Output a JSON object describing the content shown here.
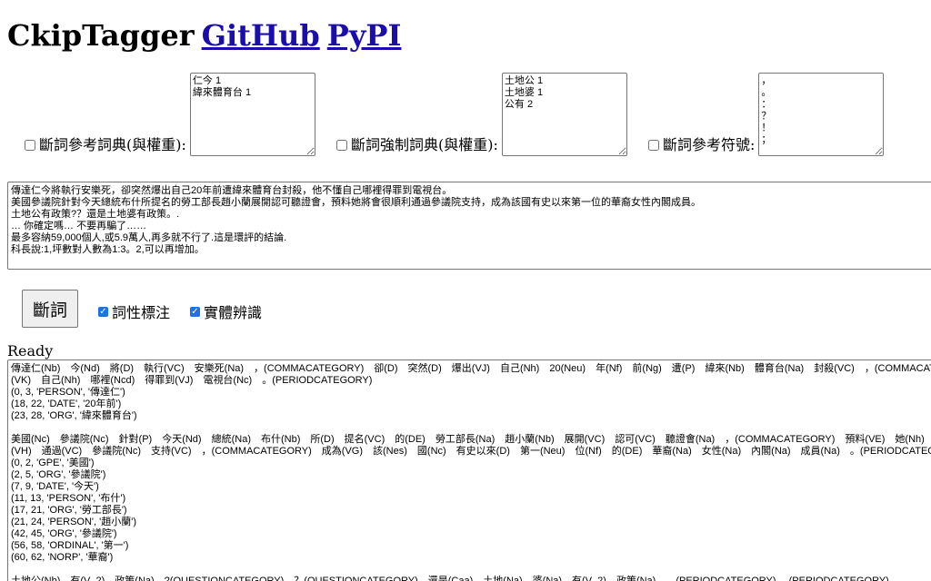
{
  "header": {
    "title": "CkipTagger",
    "github_link": "GitHub",
    "pypi_link": "PyPI"
  },
  "options": {
    "recommend_dict": {
      "label": "斷詞參考詞典(與權重):",
      "checked": false,
      "value": "仁今 1\n緯來體育台 1"
    },
    "coerce_dict": {
      "label": "斷詞強制詞典(與權重):",
      "checked": false,
      "value": "土地公 1\n土地婆 1\n公有 2"
    },
    "delimiters": {
      "label": "斷詞參考符號:",
      "checked": false,
      "value": "，\n。\n：\n？\n！\n；"
    }
  },
  "input_text": "傳達仁今將執行安樂死，卻突然爆出自己20年前遭緯來體育台封殺，他不懂自己哪裡得罪到電視台。\n美國參議院針對今天總統布什所提名的勞工部長趙小蘭展開認可聽證會，預料她將會很順利通過參議院支持，成為該國有史以來第一位的華裔女性內閣成員。\n土地公有政策?？還是土地婆有政策。.\n… 你確定嗎… 不要再騙了……\n最多容納59,000個人,或5.9萬人,再多就不行了.這是環評的結論.\n科長說:1,坪數對人數為1:3。2,可以再增加。",
  "controls": {
    "run_button": "斷詞",
    "pos_label": "詞性標注",
    "pos_checked": true,
    "ner_label": "實體辨識",
    "ner_checked": true
  },
  "status": "Ready",
  "output_text": "傳達仁(Nb)　今(Nd)　將(D)　執行(VC)　安樂死(Na)　，(COMMACATEGORY)　卻(D)　突然(D)　爆出(VJ)　自己(Nh)　20(Neu)　年(Nf)　前(Ng)　遭(P)　緯來(Nb)　體育台(Na)　封殺(VC)　，(COMMACATEGORY)　他(Nh)　不(D)　懂\n(VK)　自己(Nh)　哪裡(Ncd)　得罪到(VJ)　電視台(Nc)　。(PERIODCATEGORY)\n(0, 3, 'PERSON', '傳達仁')\n(18, 22, 'DATE', '20年前')\n(23, 28, 'ORG', '緯來體育台')\n\n美國(Nc)　參議院(Nc)　針對(P)　今天(Nd)　總統(Na)　布什(Nb)　所(D)　提名(VC)　的(DE)　勞工部長(Na)　趙小蘭(Nb)　展開(VC)　認可(VC)　聽證會(Na)　，(COMMACATEGORY)　預料(VE)　她(Nh)　將(D)　會(D)　很(Dfa)　順利\n(VH)　通過(VC)　參議院(Nc)　支持(VC)　，(COMMACATEGORY)　成為(VG)　該(Nes)　國(Nc)　有史以來(D)　第一(Neu)　位(Nf)　的(DE)　華裔(Na)　女性(Na)　內閣(Na)　成員(Na)　。(PERIODCATEGORY)\n(0, 2, 'GPE', '美國')\n(2, 5, 'ORG', '參議院')\n(7, 9, 'DATE', '今天')\n(11, 13, 'PERSON', '布什')\n(17, 21, 'ORG', '勞工部長')\n(21, 24, 'PERSON', '趙小蘭')\n(42, 45, 'ORG', '參議院')\n(56, 58, 'ORDINAL', '第一')\n(60, 62, 'NORP', '華裔')\n\n土地公(Nb)　有(V_2)　政策(Na)　?(QUESTIONCATEGORY)　？(QUESTIONCATEGORY)　還是(Caa)　土地(Na)　婆(Na)　有(V_2)　政策(Na)　。(PERIODCATEGORY)　.(PERIODCATEGORY)"
}
